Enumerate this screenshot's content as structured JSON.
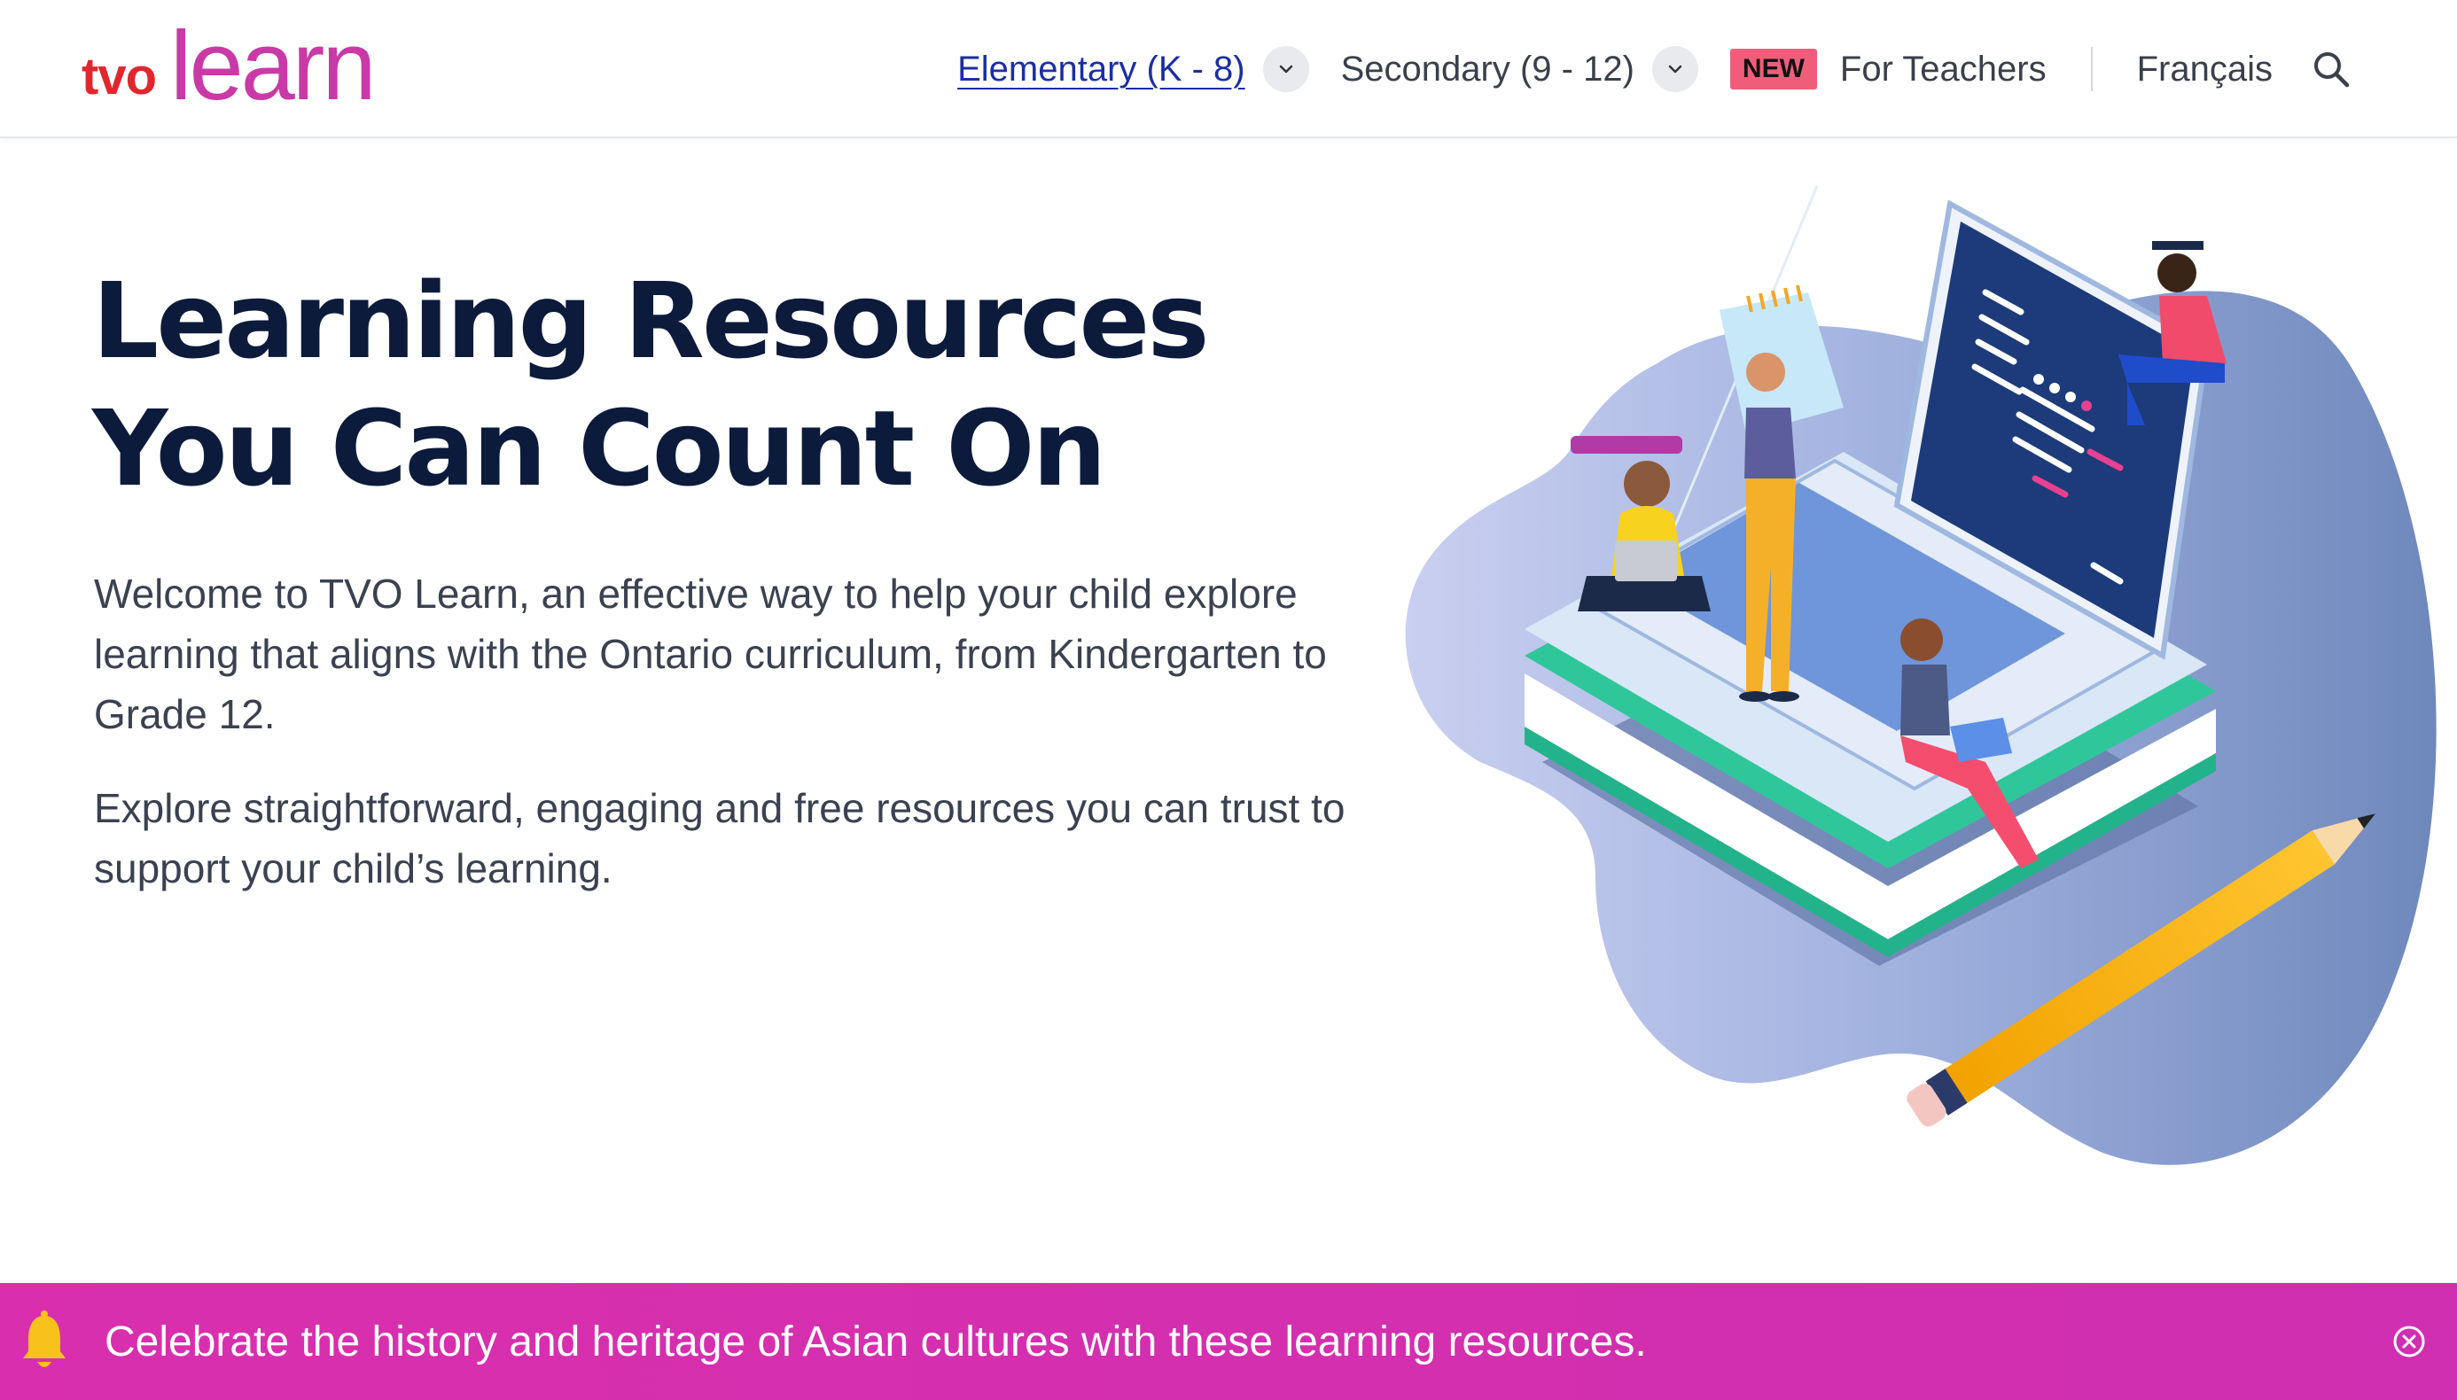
{
  "header": {
    "logo": {
      "tvo": "tvo",
      "learn": "learn"
    },
    "nav": {
      "elementary": "Elementary (K - 8)",
      "secondary": "Secondary (9 - 12)",
      "new_badge": "NEW",
      "teachers": "For Teachers",
      "language": "Français"
    },
    "icons": [
      "chevron-down-icon",
      "chevron-down-icon",
      "search-icon"
    ]
  },
  "hero": {
    "title_line1": "Learning Resources",
    "title_line2": "You Can Count On",
    "paragraph1": "Welcome to TVO Learn, an effective way to help your child explore learning that aligns with the Ontario curriculum, from Kindergarten to Grade 12.",
    "paragraph2": "Explore straightforward, engaging and free resources you can trust to support your child’s learning."
  },
  "banner": {
    "text": "Celebrate the history and heritage of Asian cultures with these learning resources.",
    "icon": "bell-icon",
    "close_icon": "close-icon"
  },
  "colors": {
    "brand_red": "#e0272e",
    "brand_magenta": "#c93aa7",
    "banner": "#d92fae",
    "heading": "#0c1a3c",
    "new_badge": "#f05d7a"
  }
}
